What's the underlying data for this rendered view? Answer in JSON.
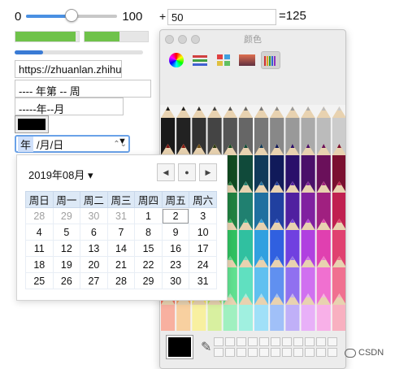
{
  "range": {
    "min_label": "0",
    "max_label": "100",
    "value": 50
  },
  "number": {
    "plus": "+",
    "value": "50",
    "result": "=125"
  },
  "meters": [
    {
      "fill": 0.95
    },
    {
      "fill": 0.55
    }
  ],
  "progress": {
    "fill": 0.22
  },
  "url_field": {
    "value": "https://zhuanlan.zhihu"
  },
  "week_field": {
    "value": "---- 年第 -- 周"
  },
  "month_field": {
    "value": "-----年--月"
  },
  "color_field": {
    "value": "#000000"
  },
  "date_field": {
    "year_seg": "年",
    "rest": "/月/日",
    "spin": "⌃⌄",
    "caret": "▼"
  },
  "calendar": {
    "month_label": "2019年08月 ▾",
    "nav": {
      "prev": "◀",
      "today": "●",
      "next": "▶"
    },
    "weekdays": [
      "周日",
      "周一",
      "周二",
      "周三",
      "周四",
      "周五",
      "周六"
    ],
    "weeks": [
      [
        "28",
        "29",
        "30",
        "31",
        "1",
        "2",
        "3"
      ],
      [
        "4",
        "5",
        "6",
        "7",
        "8",
        "9",
        "10"
      ],
      [
        "11",
        "12",
        "13",
        "14",
        "15",
        "16",
        "17"
      ],
      [
        "18",
        "19",
        "20",
        "21",
        "22",
        "23",
        "24"
      ],
      [
        "25",
        "26",
        "27",
        "28",
        "29",
        "30",
        "31"
      ]
    ],
    "muted": [
      [
        0,
        0
      ],
      [
        0,
        1
      ],
      [
        0,
        2
      ],
      [
        0,
        3
      ]
    ],
    "today": [
      0,
      5
    ]
  },
  "color_window": {
    "title": "颜色"
  },
  "watermark": {
    "label": "CSDN"
  }
}
